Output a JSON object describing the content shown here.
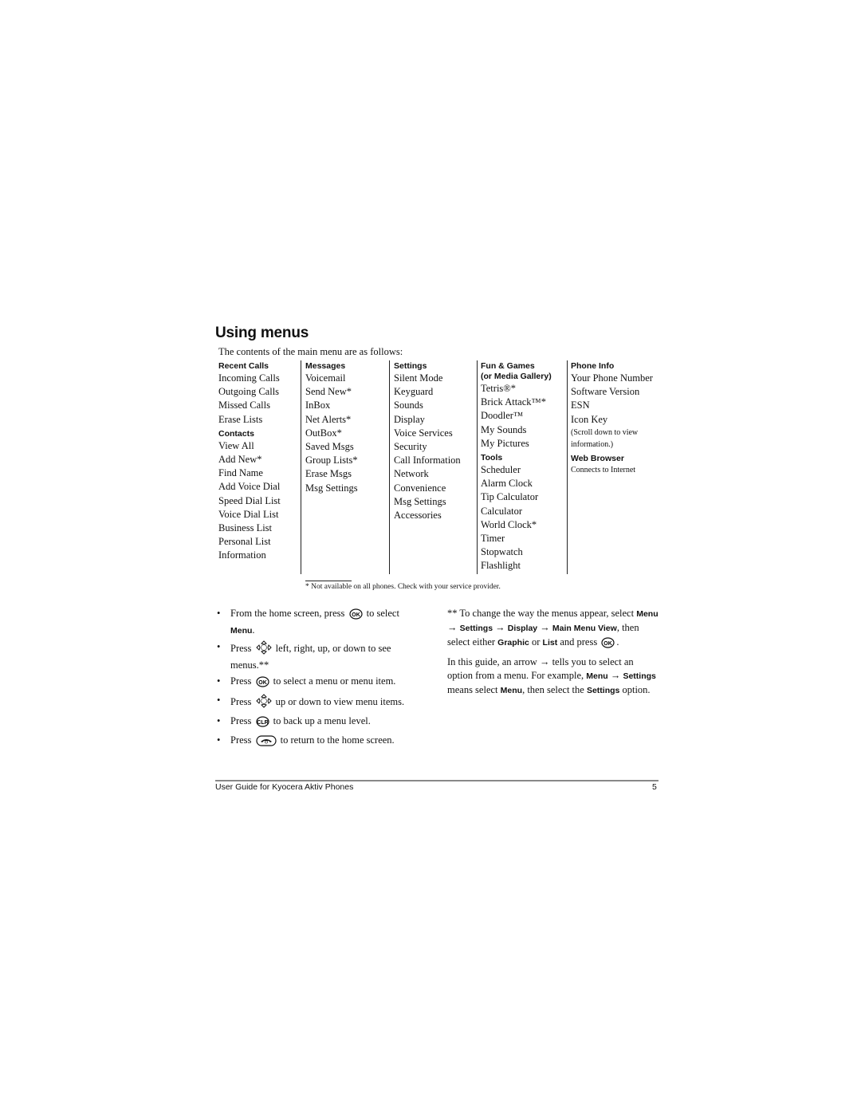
{
  "title": "Using menus",
  "intro": "The contents of the main menu are as follows:",
  "columns": [
    {
      "sections": [
        {
          "header": "Recent Calls",
          "items": [
            "Incoming Calls",
            "Outgoing Calls",
            "Missed Calls",
            "Erase Lists"
          ]
        },
        {
          "header": "Contacts",
          "items": [
            "View All",
            "Add New*",
            "Find Name",
            "Add Voice Dial",
            "Speed Dial List",
            "Voice Dial List",
            "Business List",
            "Personal List",
            "Information"
          ]
        }
      ]
    },
    {
      "sections": [
        {
          "header": "Messages",
          "items": [
            "Voicemail",
            "Send New*",
            "InBox",
            "Net Alerts*",
            "OutBox*",
            "Saved Msgs",
            "Group Lists*",
            "Erase Msgs",
            "Msg Settings"
          ]
        }
      ]
    },
    {
      "sections": [
        {
          "header": "Settings",
          "items": [
            "Silent Mode",
            "Keyguard",
            "Sounds",
            "Display",
            "Voice Services",
            "Security",
            "Call Information",
            "Network",
            "Convenience",
            "Msg Settings",
            "Accessories"
          ]
        }
      ]
    },
    {
      "sections": [
        {
          "header": "Fun & Games",
          "header2": "(or Media Gallery)",
          "items": [
            "Tetris®*",
            "Brick Attack™*",
            "Doodler™",
            "My Sounds",
            "My Pictures"
          ]
        },
        {
          "header": "Tools",
          "items": [
            "Scheduler",
            "Alarm Clock",
            "Tip Calculator",
            "Calculator",
            "World Clock*",
            "Timer",
            "Stopwatch",
            "Flashlight"
          ]
        }
      ]
    },
    {
      "sections": [
        {
          "header": "Phone Info",
          "items": [
            "Your Phone Number",
            "Software Version",
            "ESN",
            "Icon Key"
          ],
          "note": [
            "(Scroll down to view",
            "information.)"
          ]
        },
        {
          "header": "Web Browser",
          "small_items": [
            "Connects to Internet"
          ]
        }
      ]
    }
  ],
  "footnote": "* Not available on all phones. Check with your service provider.",
  "bullets": {
    "b1_pre": "From the home screen, press",
    "b1_post": "to select",
    "b1_key": "Menu",
    "b1_end": ".",
    "b2_pre": "Press",
    "b2_post": "left, right, up, or down to see menus.**",
    "b3_pre": "Press",
    "b3_post": "to select a menu or menu item.",
    "b4_pre": "Press",
    "b4_post": "up or down to view menu items.",
    "b5_pre": "Press",
    "b5_post": "to back up a menu level.",
    "b6_pre": "Press",
    "b6_post": "to return to the home screen."
  },
  "right": {
    "p1_a": "** To change the way the menus appear, select",
    "p1_menu": "Menu",
    "p1_settings": "Settings",
    "p1_display": "Display",
    "p1_view": "Main Menu View",
    "p1_b": "then select either",
    "p1_graphic": "Graphic",
    "p1_or": "or",
    "p1_list": "List",
    "p1_c": "and press",
    "p2_a": "In this guide, an arrow → tells you to select an option from a menu. For example,",
    "p2_menu": "Menu",
    "p2_settings": "Settings",
    "p2_b": "means select",
    "p2_menu2": "Menu",
    "p2_c": ", then select the",
    "p2_settings2": "Settings",
    "p2_d": "option.",
    "arrow": "→"
  },
  "footer": {
    "left": "User Guide for Kyocera Aktiv Phones",
    "page": "5"
  },
  "icons": [
    "ok-key-icon",
    "nav-key-icon",
    "clear-key-icon",
    "end-key-icon"
  ]
}
